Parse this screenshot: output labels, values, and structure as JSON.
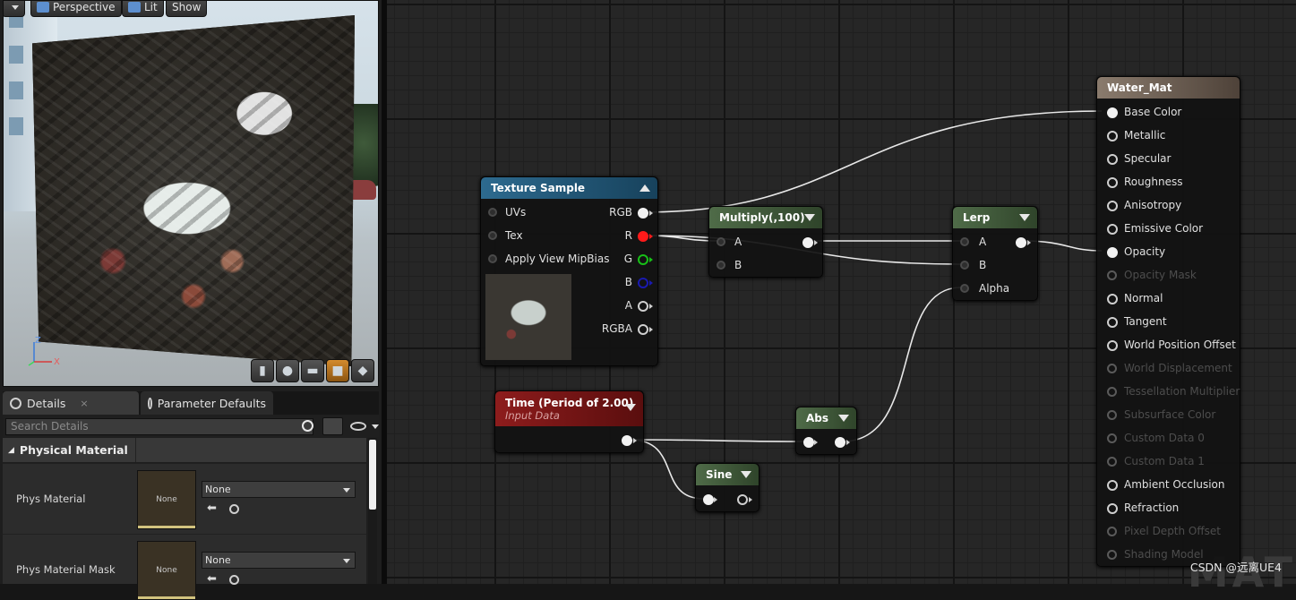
{
  "viewport": {
    "buttons": {
      "perspective": "Perspective",
      "lit": "Lit",
      "show": "Show"
    },
    "axis": {
      "z": "Z",
      "x": "X"
    }
  },
  "details": {
    "tabs": [
      {
        "label": "Details"
      },
      {
        "label": "Parameter Defaults"
      }
    ],
    "close": "×",
    "search_placeholder": "Search Details",
    "category": "Physical Material",
    "rows": [
      {
        "label": "Phys Material",
        "thumb": "None",
        "value": "None"
      },
      {
        "label": "Phys Material Mask",
        "thumb": "None",
        "value": "None"
      }
    ]
  },
  "graph": {
    "texture_sample": {
      "title": "Texture Sample",
      "inputs": [
        "UVs",
        "Tex",
        "Apply View MipBias"
      ],
      "outputs": [
        "RGB",
        "R",
        "G",
        "B",
        "A",
        "RGBA"
      ]
    },
    "multiply": {
      "title": "Multiply(,100)",
      "inputs": [
        "A",
        "B"
      ]
    },
    "lerp": {
      "title": "Lerp",
      "inputs": [
        "A",
        "B",
        "Alpha"
      ]
    },
    "time": {
      "title": "Time (Period of 2.00)",
      "subtitle": "Input Data"
    },
    "abs": {
      "title": "Abs"
    },
    "sine": {
      "title": "Sine"
    },
    "water_mat": {
      "title": "Water_Mat",
      "inputs": [
        {
          "label": "Base Color",
          "state": "connected"
        },
        {
          "label": "Metallic",
          "state": "active"
        },
        {
          "label": "Specular",
          "state": "active"
        },
        {
          "label": "Roughness",
          "state": "active"
        },
        {
          "label": "Anisotropy",
          "state": "active"
        },
        {
          "label": "Emissive Color",
          "state": "active"
        },
        {
          "label": "Opacity",
          "state": "connected"
        },
        {
          "label": "Opacity Mask",
          "state": "disabled"
        },
        {
          "label": "Normal",
          "state": "active"
        },
        {
          "label": "Tangent",
          "state": "active"
        },
        {
          "label": "World Position Offset",
          "state": "active"
        },
        {
          "label": "World Displacement",
          "state": "disabled"
        },
        {
          "label": "Tessellation Multiplier",
          "state": "disabled"
        },
        {
          "label": "Subsurface Color",
          "state": "disabled"
        },
        {
          "label": "Custom Data 0",
          "state": "disabled"
        },
        {
          "label": "Custom Data 1",
          "state": "disabled"
        },
        {
          "label": "Ambient Occlusion",
          "state": "active"
        },
        {
          "label": "Refraction",
          "state": "active"
        },
        {
          "label": "Pixel Depth Offset",
          "state": "disabled"
        },
        {
          "label": "Shading Model",
          "state": "disabled"
        }
      ]
    }
  },
  "watermark": "CSDN @远离UE4",
  "graph_bg_text": "MAT",
  "colors": {
    "texture_header": "#2d6a8f",
    "multiply_header": "#4f6b48",
    "time_header": "#8d1c1c",
    "red_pin": "#ff1a1a",
    "green_pin": "#18c018",
    "blue_pin": "#1a1ab0"
  }
}
